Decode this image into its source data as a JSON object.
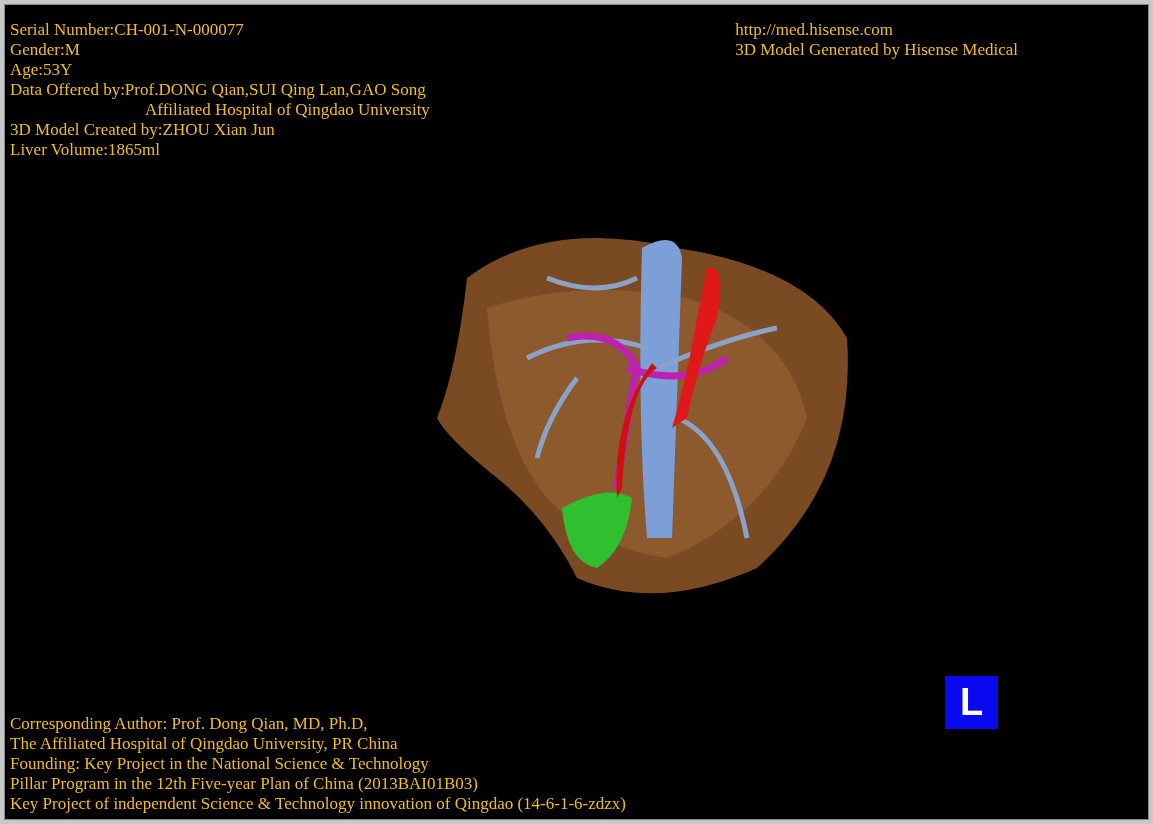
{
  "patient_info": [
    {
      "text": "Serial Number:CH-001-N-000077",
      "kind": "line"
    },
    {
      "text": "Gender:M",
      "kind": "line"
    },
    {
      "text": "Age:53Y",
      "kind": "line"
    },
    {
      "text": "Data Offered by:Prof.DONG Qian,SUI Qing Lan,GAO Song",
      "kind": "line"
    },
    {
      "text": "Affiliated Hospital of Qingdao University",
      "kind": "continuation"
    },
    {
      "text": "3D Model Created by:ZHOU Xian Jun",
      "kind": "line"
    },
    {
      "text": "Liver Volume:1865ml",
      "kind": "line"
    }
  ],
  "vendor_info": [
    "http://med.hisense.com",
    "3D Model Generated by Hisense Medical"
  ],
  "credits": [
    "Corresponding Author: Prof. Dong Qian, MD, Ph.D,",
    "The Affiliated Hospital of Qingdao University, PR China",
    "Founding: Key Project in the National Science & Technology",
    "Pillar Program in the 12th Five-year Plan of China (2013BAI01B03)",
    "Key Project of independent Science & Technology innovation of Qingdao (14-6-1-6-zdzx)"
  ],
  "orientation_marker": "L"
}
